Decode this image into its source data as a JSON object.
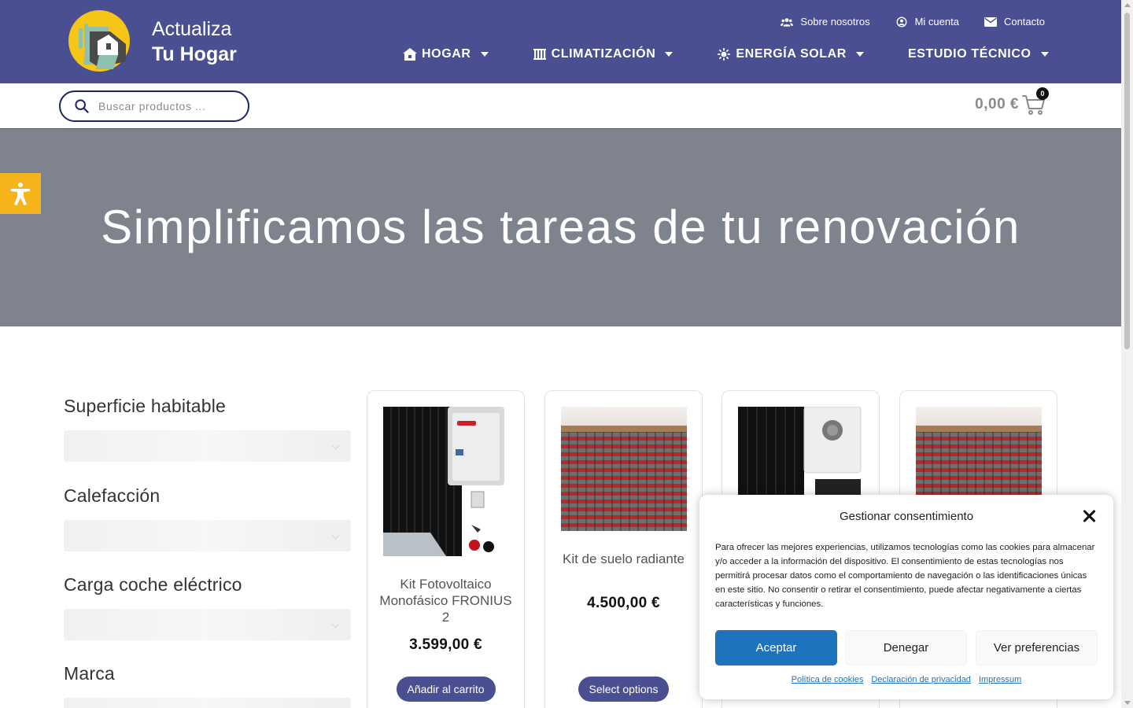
{
  "brand": {
    "line1": "Actualiza",
    "line2": "Tu Hogar"
  },
  "top_nav": [
    {
      "label": "Sobre nosotros",
      "icon": "users-icon"
    },
    {
      "label": "Mi cuenta",
      "icon": "user-circle-icon"
    },
    {
      "label": "Contacto",
      "icon": "envelope-icon"
    }
  ],
  "main_nav": [
    {
      "label": "HOGAR",
      "icon": "home-icon"
    },
    {
      "label": "CLIMATIZACIÓN",
      "icon": "radiator-icon"
    },
    {
      "label": "ENERGÍA SOLAR",
      "icon": "sun-icon"
    },
    {
      "label": "ESTUDIO TÉCNICO",
      "icon": ""
    }
  ],
  "search": {
    "placeholder": "Buscar productos ..."
  },
  "cart": {
    "total": "0,00 €",
    "count": "0"
  },
  "hero": {
    "title": "Simplificamos las tareas de tu renovación"
  },
  "filters": [
    {
      "label": "Superficie habitable"
    },
    {
      "label": "Calefacción"
    },
    {
      "label": "Carga coche eléctrico"
    },
    {
      "label": "Marca"
    }
  ],
  "products": [
    {
      "name": "Kit Fotovoltaico Monofásico FRONIUS 2",
      "price": "3.599,00 €",
      "button": "Añadir al carrito"
    },
    {
      "name": "Kit de suelo radiante",
      "price": "4.500,00 €",
      "button": "Select options"
    },
    {
      "name": "",
      "price": "",
      "button": ""
    },
    {
      "name": "",
      "price": "",
      "button": ""
    }
  ],
  "consent": {
    "title": "Gestionar consentimiento",
    "text": "Para ofrecer las mejores experiencias, utilizamos tecnologías como las cookies para almacenar y/o acceder a la información del dispositivo. El consentimiento de estas tecnologías nos permitirá procesar datos como el comportamiento de navegación o las identificaciones únicas en este sitio. No consentir o retirar el consentimiento, puede afectar negativamente a ciertas características y funciones.",
    "accept": "Aceptar",
    "deny": "Denegar",
    "preferences": "Ver preferencias",
    "links": [
      "Política de cookies",
      "Declaración de privacidad",
      "Impressum"
    ]
  },
  "colors": {
    "header": "#4a4f91",
    "hero": "#7f838e",
    "accent_button": "#1e73be",
    "accessibility": "#f5b41a"
  }
}
